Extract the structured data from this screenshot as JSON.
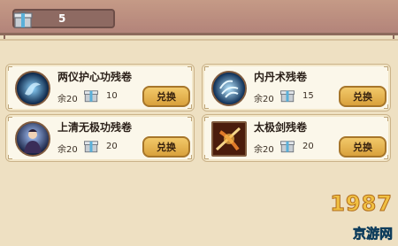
{
  "header": {
    "item_count": "5",
    "item_icon": "gift-box-icon"
  },
  "items": [
    {
      "title": "两仪护心功残卷",
      "remain": "余20",
      "cost": "10",
      "button": "兑换",
      "thumb": "skill-orb-icon"
    },
    {
      "title": "内丹术残卷",
      "remain": "余20",
      "cost": "15",
      "button": "兑换",
      "thumb": "skill-orb-icon"
    },
    {
      "title": "上清无极功残卷",
      "remain": "余20",
      "cost": "20",
      "button": "兑换",
      "thumb": "warrior-portrait-icon"
    },
    {
      "title": "太极剑残卷",
      "remain": "余20",
      "cost": "20",
      "button": "兑换",
      "thumb": "sword-art-icon"
    }
  ],
  "watermark": {
    "big": "1987",
    "small": "京游网"
  },
  "colors": {
    "button_fill": "#e7b755",
    "card_bg": "#fbf7ea",
    "header": "#b98a7e"
  }
}
